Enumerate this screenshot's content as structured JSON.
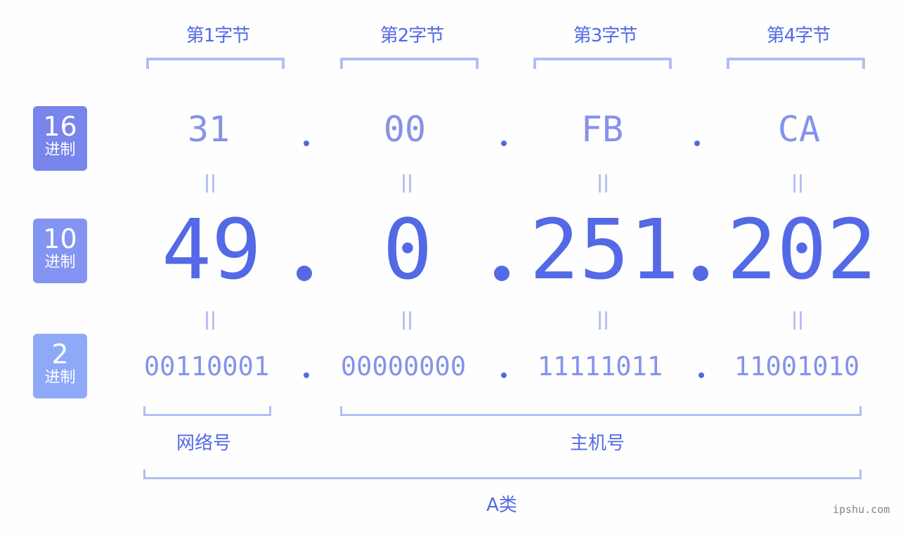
{
  "byte_headers": [
    "第1字节",
    "第2字节",
    "第3字节",
    "第4字节"
  ],
  "radix_badges": [
    {
      "num": "16",
      "unit": "进制",
      "color": "#7885eb"
    },
    {
      "num": "10",
      "unit": "进制",
      "color": "#8494f2"
    },
    {
      "num": "2",
      "unit": "进制",
      "color": "#8ea9f7"
    }
  ],
  "hex": [
    "31",
    "00",
    "FB",
    "CA"
  ],
  "decimal": [
    "49",
    "0",
    "251",
    "202"
  ],
  "binary": [
    "00110001",
    "00000000",
    "11111011",
    "11001010"
  ],
  "segments": {
    "network": "网络号",
    "host": "主机号",
    "class": "A类"
  },
  "watermark": "ipshu.com",
  "colors": {
    "accent": "#5369e6",
    "light_accent": "#8592ec",
    "bracket": "#b3bcf5"
  }
}
